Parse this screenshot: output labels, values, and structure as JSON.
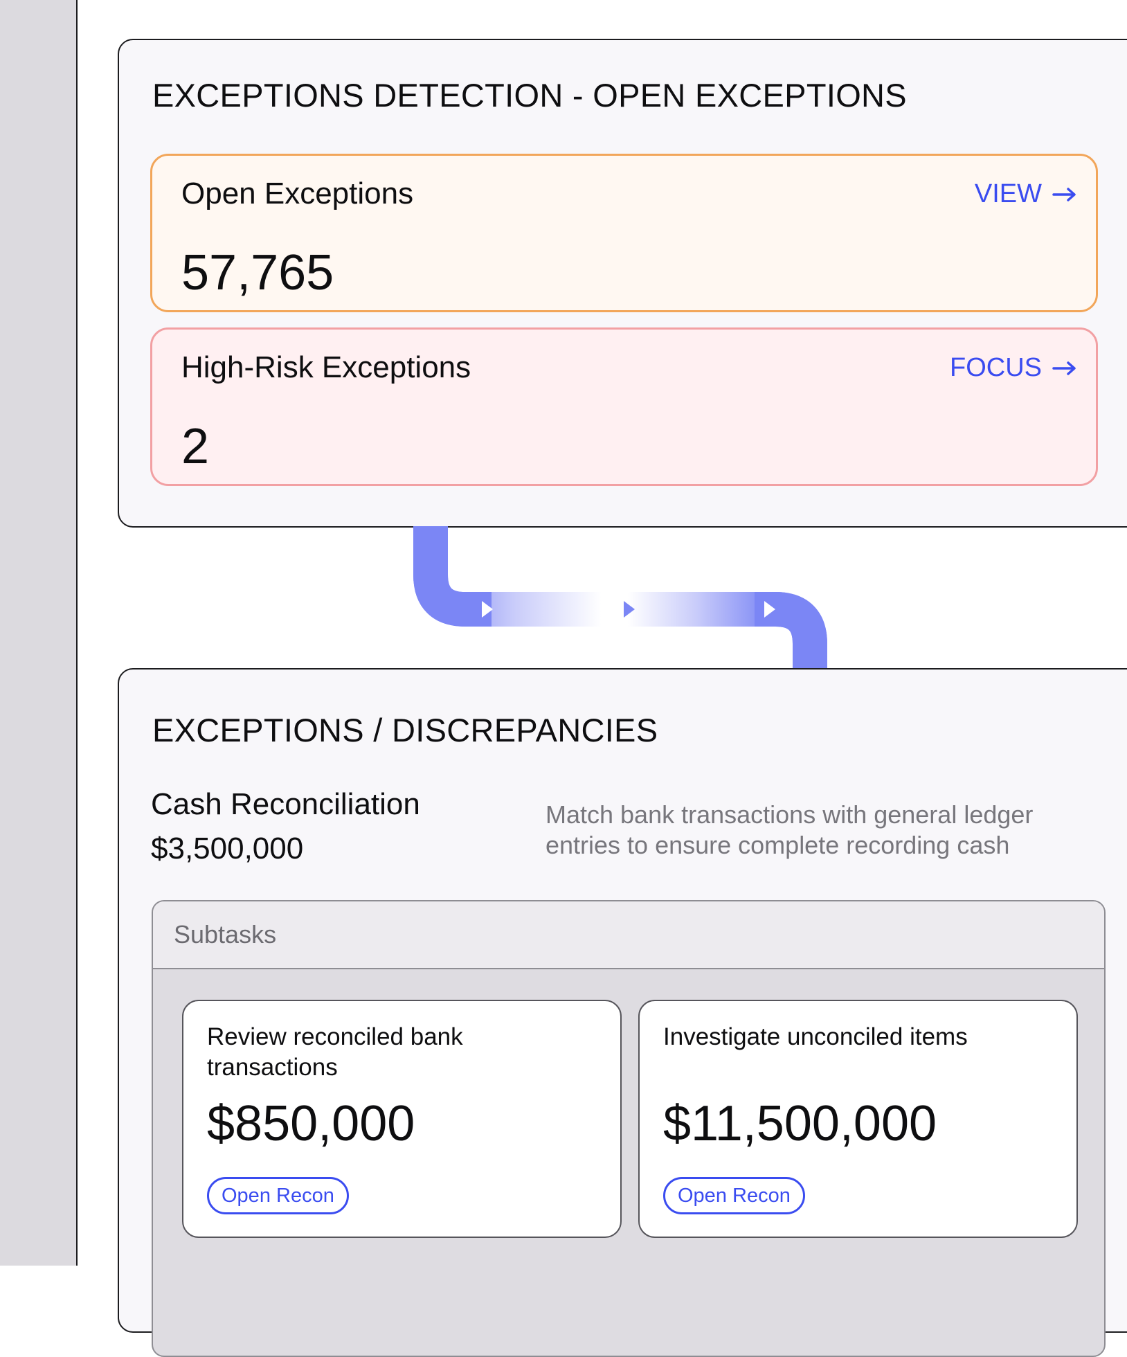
{
  "exceptions_panel": {
    "title": "EXCEPTIONS DETECTION - OPEN EXCEPTIONS",
    "cards": [
      {
        "label": "Open Exceptions",
        "value": "57,765",
        "action": "VIEW",
        "icon": "arrow-right-icon",
        "accent": "#f2a65a"
      },
      {
        "label": "High-Risk Exceptions",
        "value": "2",
        "action": "FOCUS",
        "icon": "arrow-right-icon",
        "accent": "#f2a0a3"
      }
    ]
  },
  "discrepancies_panel": {
    "title": "EXCEPTIONS / DISCREPANCIES",
    "section_name": "Cash Reconciliation",
    "section_amount": "$3,500,000",
    "description": "Match bank transactions with general ledger entries to ensure complete recording cash",
    "subtasks": {
      "header": "Subtasks",
      "items": [
        {
          "title": "Review reconciled bank transactions",
          "amount": "$850,000",
          "button": "Open Recon"
        },
        {
          "title": "Investigate unconciled items",
          "amount": "$11,500,000",
          "button": "Open Recon"
        }
      ]
    }
  },
  "colors": {
    "link": "#3a4cf0",
    "connector": "#7b86f5"
  }
}
